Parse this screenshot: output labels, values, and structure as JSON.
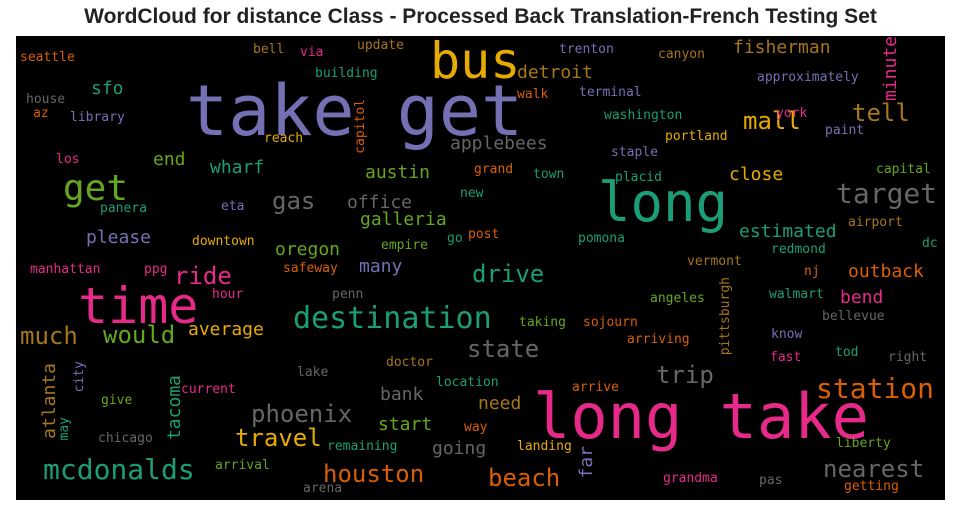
{
  "title": "WordCloud for distance Class - Processed Back Translation-French Testing Set",
  "colors": {
    "pink": "#e7298a",
    "purple": "#7570b3",
    "teal": "#1b9e77",
    "green": "#66a61e",
    "gold": "#e6ab02",
    "orange": "#d95f02",
    "brown": "#a6761d",
    "gray": "#666666"
  },
  "words": [
    {
      "text": "take get",
      "color": "purple"
    },
    {
      "text": "long take",
      "color": "pink"
    },
    {
      "text": "long",
      "color": "teal"
    },
    {
      "text": "time",
      "color": "pink"
    },
    {
      "text": "bus",
      "color": "gold"
    },
    {
      "text": "get",
      "color": "green"
    },
    {
      "text": "destination",
      "color": "teal"
    },
    {
      "text": "mcdonalds",
      "color": "teal"
    },
    {
      "text": "target",
      "color": "gray"
    },
    {
      "text": "station",
      "color": "orange"
    },
    {
      "text": "phoenix",
      "color": "gray"
    },
    {
      "text": "houston",
      "color": "orange"
    },
    {
      "text": "travel",
      "color": "gold"
    },
    {
      "text": "nearest",
      "color": "gray"
    },
    {
      "text": "beach",
      "color": "orange"
    },
    {
      "text": "drive",
      "color": "teal"
    },
    {
      "text": "state",
      "color": "gray"
    },
    {
      "text": "trip",
      "color": "gray"
    },
    {
      "text": "would",
      "color": "green"
    },
    {
      "text": "much",
      "color": "brown"
    },
    {
      "text": "mall",
      "color": "gold"
    },
    {
      "text": "tell",
      "color": "brown"
    },
    {
      "text": "ride",
      "color": "pink"
    },
    {
      "text": "gas",
      "color": "gray"
    },
    {
      "text": "fisherman",
      "color": "brown"
    },
    {
      "text": "detroit",
      "color": "brown"
    },
    {
      "text": "galleria",
      "color": "green"
    },
    {
      "text": "austin",
      "color": "green"
    },
    {
      "text": "office",
      "color": "gray"
    },
    {
      "text": "applebees",
      "color": "gray"
    },
    {
      "text": "wharf",
      "color": "teal"
    },
    {
      "text": "oregon",
      "color": "green"
    },
    {
      "text": "please",
      "color": "purple"
    },
    {
      "text": "average",
      "color": "gold"
    },
    {
      "text": "estimated",
      "color": "teal"
    },
    {
      "text": "close",
      "color": "gold"
    },
    {
      "text": "outback",
      "color": "orange"
    },
    {
      "text": "many",
      "color": "purple"
    },
    {
      "text": "going",
      "color": "gray"
    },
    {
      "text": "start",
      "color": "green"
    },
    {
      "text": "need",
      "color": "brown"
    },
    {
      "text": "bank",
      "color": "gray"
    },
    {
      "text": "atlanta",
      "color": "brown"
    },
    {
      "text": "tacoma",
      "color": "teal"
    },
    {
      "text": "end",
      "color": "green"
    },
    {
      "text": "sfo",
      "color": "teal"
    },
    {
      "text": "bend",
      "color": "pink"
    },
    {
      "text": "minute",
      "color": "pink"
    },
    {
      "text": "far",
      "color": "purple"
    },
    {
      "text": "seattle",
      "color": "orange"
    },
    {
      "text": "house",
      "color": "gray"
    },
    {
      "text": "az",
      "color": "orange"
    },
    {
      "text": "library",
      "color": "purple"
    },
    {
      "text": "los",
      "color": "pink"
    },
    {
      "text": "panera",
      "color": "teal"
    },
    {
      "text": "eta",
      "color": "purple"
    },
    {
      "text": "downtown",
      "color": "gold"
    },
    {
      "text": "manhattan",
      "color": "pink"
    },
    {
      "text": "ppg",
      "color": "pink"
    },
    {
      "text": "hour",
      "color": "pink"
    },
    {
      "text": "safeway",
      "color": "orange"
    },
    {
      "text": "penn",
      "color": "gray"
    },
    {
      "text": "bell",
      "color": "brown"
    },
    {
      "text": "via",
      "color": "pink"
    },
    {
      "text": "update",
      "color": "brown"
    },
    {
      "text": "building",
      "color": "teal"
    },
    {
      "text": "trenton",
      "color": "purple"
    },
    {
      "text": "canyon",
      "color": "brown"
    },
    {
      "text": "approximately",
      "color": "purple"
    },
    {
      "text": "reach",
      "color": "gold"
    },
    {
      "text": "capitol",
      "color": "orange"
    },
    {
      "text": "walk",
      "color": "orange"
    },
    {
      "text": "terminal",
      "color": "purple"
    },
    {
      "text": "washington",
      "color": "teal"
    },
    {
      "text": "york",
      "color": "pink"
    },
    {
      "text": "portland",
      "color": "gold"
    },
    {
      "text": "paint",
      "color": "purple"
    },
    {
      "text": "staple",
      "color": "purple"
    },
    {
      "text": "grand",
      "color": "orange"
    },
    {
      "text": "town",
      "color": "teal"
    },
    {
      "text": "placid",
      "color": "teal"
    },
    {
      "text": "capital",
      "color": "green"
    },
    {
      "text": "new",
      "color": "teal"
    },
    {
      "text": "airport",
      "color": "brown"
    },
    {
      "text": "post",
      "color": "orange"
    },
    {
      "text": "go",
      "color": "teal"
    },
    {
      "text": "empire",
      "color": "green"
    },
    {
      "text": "pomona",
      "color": "teal"
    },
    {
      "text": "redmond",
      "color": "teal"
    },
    {
      "text": "dc",
      "color": "teal"
    },
    {
      "text": "vermont",
      "color": "brown"
    },
    {
      "text": "nj",
      "color": "orange"
    },
    {
      "text": "angeles",
      "color": "green"
    },
    {
      "text": "pittsburgh",
      "color": "brown"
    },
    {
      "text": "walmart",
      "color": "teal"
    },
    {
      "text": "bellevue",
      "color": "gray"
    },
    {
      "text": "taking",
      "color": "green"
    },
    {
      "text": "sojourn",
      "color": "orange"
    },
    {
      "text": "arriving",
      "color": "orange"
    },
    {
      "text": "know",
      "color": "purple"
    },
    {
      "text": "tod",
      "color": "teal"
    },
    {
      "text": "fast",
      "color": "pink"
    },
    {
      "text": "right",
      "color": "gray"
    },
    {
      "text": "doctor",
      "color": "brown"
    },
    {
      "text": "lake",
      "color": "gray"
    },
    {
      "text": "city",
      "color": "purple"
    },
    {
      "text": "current",
      "color": "pink"
    },
    {
      "text": "location",
      "color": "teal"
    },
    {
      "text": "arrive",
      "color": "orange"
    },
    {
      "text": "may",
      "color": "teal"
    },
    {
      "text": "give",
      "color": "green"
    },
    {
      "text": "way",
      "color": "orange"
    },
    {
      "text": "chicago",
      "color": "gray"
    },
    {
      "text": "remaining",
      "color": "teal"
    },
    {
      "text": "landing",
      "color": "gold"
    },
    {
      "text": "liberty",
      "color": "green"
    },
    {
      "text": "arrival",
      "color": "green"
    },
    {
      "text": "arena",
      "color": "gray"
    },
    {
      "text": "grandma",
      "color": "pink"
    },
    {
      "text": "pas",
      "color": "gray"
    },
    {
      "text": "getting",
      "color": "orange"
    }
  ]
}
